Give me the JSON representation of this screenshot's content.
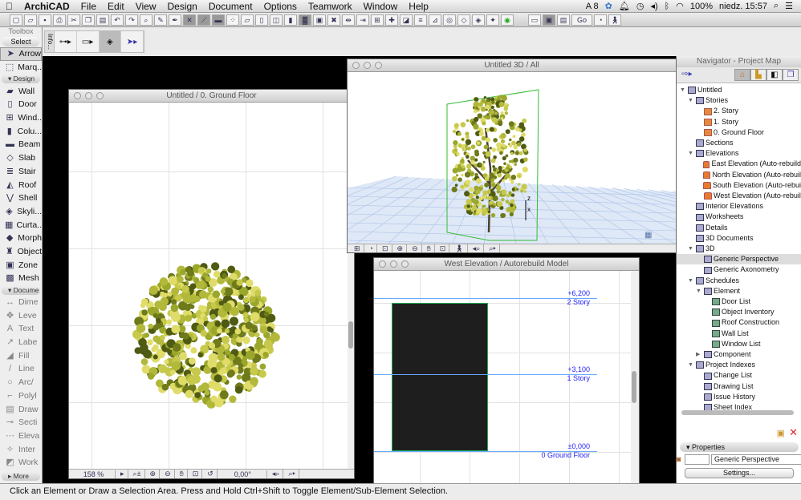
{
  "menubar": {
    "apple_icon": "apple-icon",
    "app": "ArchiCAD",
    "items": [
      "File",
      "Edit",
      "View",
      "Design",
      "Document",
      "Options",
      "Teamwork",
      "Window",
      "Help"
    ],
    "status_right": {
      "adobe": "8",
      "battery": "100%",
      "clock": "niedz. 15:57"
    }
  },
  "toolbar": {
    "go_label": "Go"
  },
  "toolbox": {
    "title": "Toolbox",
    "select": "Select",
    "select_items": [
      {
        "label": "Arrow",
        "icon": "arrow-icon",
        "active": true
      },
      {
        "label": "Marq..",
        "icon": "marquee-icon"
      }
    ],
    "design_label": "Design",
    "design_items": [
      {
        "label": "Wall"
      },
      {
        "label": "Door"
      },
      {
        "label": "Wind.."
      },
      {
        "label": "Colu..."
      },
      {
        "label": "Beam"
      },
      {
        "label": "Slab"
      },
      {
        "label": "Stair"
      },
      {
        "label": "Roof"
      },
      {
        "label": "Shell"
      },
      {
        "label": "Skyli..."
      },
      {
        "label": "Curta.."
      },
      {
        "label": "Morph"
      },
      {
        "label": "Object"
      },
      {
        "label": "Zone"
      },
      {
        "label": "Mesh"
      }
    ],
    "document_label": "Docume",
    "document_items": [
      {
        "label": "Dime"
      },
      {
        "label": "Leve"
      },
      {
        "label": "Text"
      },
      {
        "label": "Labe"
      },
      {
        "label": "Fill"
      },
      {
        "label": "Line"
      },
      {
        "label": "Arc/"
      },
      {
        "label": "Polyl"
      },
      {
        "label": "Draw"
      },
      {
        "label": "Secti"
      },
      {
        "label": "Eleva"
      },
      {
        "label": "Inter"
      },
      {
        "label": "Work"
      }
    ],
    "more": "More"
  },
  "infobox": {
    "tab": "Info..."
  },
  "floorplan": {
    "title": "Untitled / 0. Ground Floor",
    "zoom": "158 %",
    "angle": "0,00°"
  },
  "view3d": {
    "title": "Untitled 3D / All",
    "axis_z": "z",
    "axis_x": "x"
  },
  "elevation": {
    "title": "West Elevation / Autorebuild Model",
    "levels": [
      {
        "value": "+6,200",
        "name": "2 Story"
      },
      {
        "value": "+3,100",
        "name": "1 Story"
      },
      {
        "value": "±0,000",
        "name": "0 Ground Floor"
      }
    ]
  },
  "navigator": {
    "title": "Navigator - Project Map",
    "tree": [
      {
        "label": "Untitled",
        "depth": 0,
        "tw": "▼",
        "ic": "project"
      },
      {
        "label": "Stories",
        "depth": 1,
        "tw": "▼",
        "ic": "stories"
      },
      {
        "label": "2. Story",
        "depth": 2,
        "ic": "story"
      },
      {
        "label": "1. Story",
        "depth": 2,
        "ic": "story"
      },
      {
        "label": "0. Ground Floor",
        "depth": 2,
        "ic": "story"
      },
      {
        "label": "Sections",
        "depth": 1,
        "ic": "section"
      },
      {
        "label": "Elevations",
        "depth": 1,
        "tw": "▼",
        "ic": "section"
      },
      {
        "label": "East Elevation (Auto-rebuild",
        "depth": 2,
        "ic": "elev"
      },
      {
        "label": "North Elevation (Auto-rebuil",
        "depth": 2,
        "ic": "elev"
      },
      {
        "label": "South Elevation (Auto-rebui",
        "depth": 2,
        "ic": "elev"
      },
      {
        "label": "West Elevation (Auto-rebuil",
        "depth": 2,
        "ic": "elev"
      },
      {
        "label": "Interior Elevations",
        "depth": 1,
        "ic": "section"
      },
      {
        "label": "Worksheets",
        "depth": 1,
        "ic": "section"
      },
      {
        "label": "Details",
        "depth": 1,
        "ic": "section"
      },
      {
        "label": "3D Documents",
        "depth": 1,
        "ic": "section"
      },
      {
        "label": "3D",
        "depth": 1,
        "tw": "▼",
        "ic": "section"
      },
      {
        "label": "Generic Perspective",
        "depth": 2,
        "ic": "camera",
        "selected": true
      },
      {
        "label": "Generic Axonometry",
        "depth": 2,
        "ic": "camera"
      },
      {
        "label": "Schedules",
        "depth": 1,
        "tw": "▼",
        "ic": "section"
      },
      {
        "label": "Element",
        "depth": 2,
        "tw": "▼",
        "ic": "section"
      },
      {
        "label": "Door List",
        "depth": 3,
        "ic": "sched"
      },
      {
        "label": "Object Inventory",
        "depth": 3,
        "ic": "sched"
      },
      {
        "label": "Roof Construction",
        "depth": 3,
        "ic": "sched"
      },
      {
        "label": "Wall List",
        "depth": 3,
        "ic": "sched"
      },
      {
        "label": "Window List",
        "depth": 3,
        "ic": "sched"
      },
      {
        "label": "Component",
        "depth": 2,
        "tw": "▶",
        "ic": "section"
      },
      {
        "label": "Project Indexes",
        "depth": 1,
        "tw": "▼",
        "ic": "section"
      },
      {
        "label": "Change List",
        "depth": 2,
        "ic": "section"
      },
      {
        "label": "Drawing List",
        "depth": 2,
        "ic": "section"
      },
      {
        "label": "Issue History",
        "depth": 2,
        "ic": "section"
      },
      {
        "label": "Sheet Index",
        "depth": 2,
        "ic": "section"
      }
    ],
    "properties_label": "Properties",
    "properties_name": "Generic Perspective",
    "settings": "Settings..."
  },
  "statusbar": {
    "text": "Click an Element or Draw a Selection Area. Press and Hold Ctrl+Shift to Toggle Element/Sub-Element Selection."
  },
  "colors": {
    "level_text": "#2222ff",
    "level_line": "#66aaff",
    "foliage": "#9aa72a",
    "building": "#1e1e1e"
  }
}
